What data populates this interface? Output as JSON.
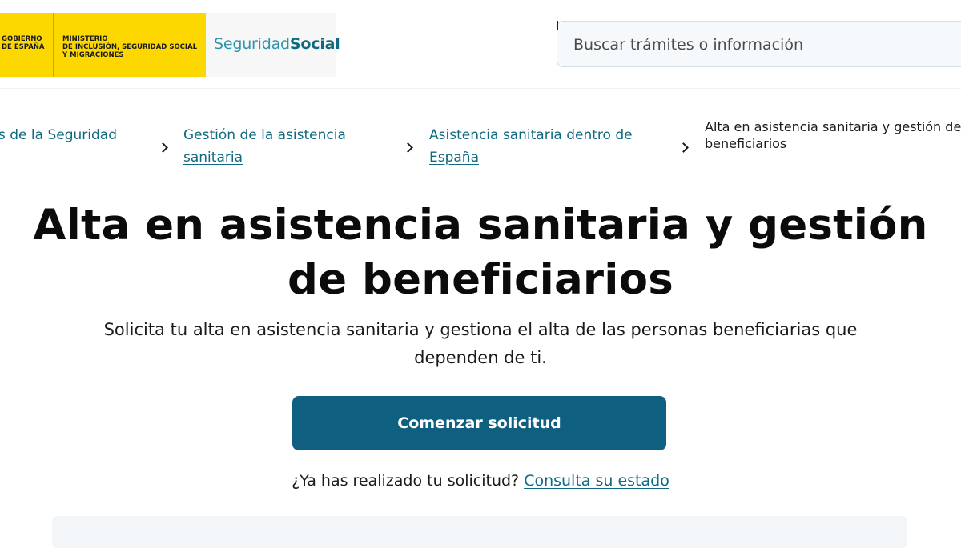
{
  "header": {
    "gov_label": "GOBIERNO\nDE ESPAÑA",
    "ministry_label": "MINISTERIO\nDE INCLUSIÓN, SEGURIDAD SOCIAL\nY MIGRACIONES",
    "ss_logo_light": "Seguridad",
    "ss_logo_bold": "Social",
    "search": {
      "placeholder": "Buscar trámites o información",
      "value": ""
    },
    "colors": {
      "gov_yellow": "#fdd800",
      "brand_teal": "#0f6980",
      "brand_teal_light": "#2d95ab"
    }
  },
  "breadcrumb": {
    "items": [
      {
        "line1": "s de la Seguridad",
        "line2": ""
      },
      {
        "line1": "Gestión de la asistencia",
        "line2": "sanitaria"
      },
      {
        "line1": "Asistencia sanitaria dentro de",
        "line2": "España"
      }
    ],
    "current": {
      "line1": "Alta en asistencia sanitaria y gestión de",
      "line2": "beneficiarios"
    },
    "separator_icon": "chevron-right-icon"
  },
  "main": {
    "title_line1": "Alta en asistencia sanitaria y gestión",
    "title_line2": "de beneficiarios",
    "subtitle_line1": "Solicita tu alta en asistencia sanitaria y gestiona el alta de las personas beneficiarias que",
    "subtitle_line2": "dependen de ti.",
    "cta_label": "Comenzar solicitud",
    "cta_color": "#0f6080",
    "status_question": "¿Ya has realizado tu solicitud?",
    "status_link": "Consulta su estado"
  }
}
